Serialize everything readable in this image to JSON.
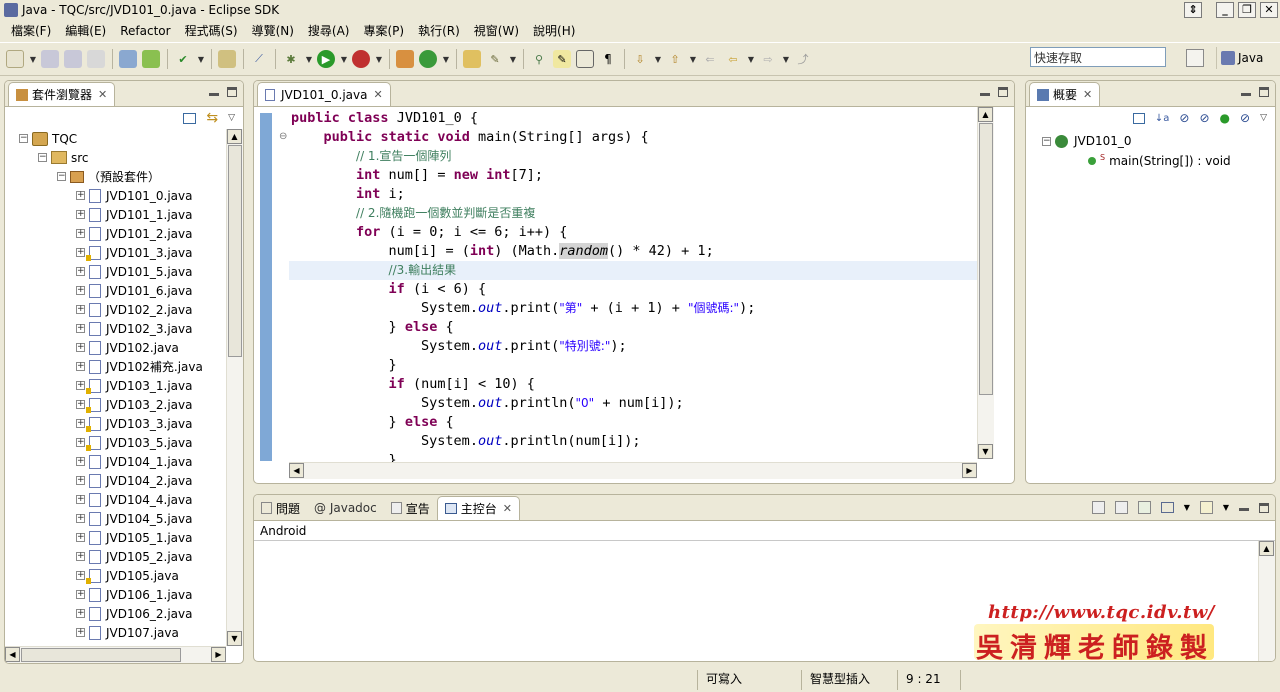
{
  "window": {
    "title": "Java - TQC/src/JVD101_0.java - Eclipse SDK"
  },
  "menu": [
    "檔案(F)",
    "編輯(E)",
    "Refactor",
    "程式碼(S)",
    "導覽(N)",
    "搜尋(A)",
    "專案(P)",
    "執行(R)",
    "視窗(W)",
    "說明(H)"
  ],
  "toolbar": {
    "quick_access": "快速存取",
    "perspective": "Java"
  },
  "package_explorer": {
    "tab": "套件瀏覽器",
    "project": "TQC",
    "src": "src",
    "package": "（預設套件）",
    "files": [
      "JVD101_0.java",
      "JVD101_1.java",
      "JVD101_2.java",
      "JVD101_3.java",
      "JVD101_5.java",
      "JVD101_6.java",
      "JVD102_2.java",
      "JVD102_3.java",
      "JVD102.java",
      "JVD102補充.java",
      "JVD103_1.java",
      "JVD103_2.java",
      "JVD103_3.java",
      "JVD103_5.java",
      "JVD104_1.java",
      "JVD104_2.java",
      "JVD104_4.java",
      "JVD104_5.java",
      "JVD105_1.java",
      "JVD105_2.java",
      "JVD105.java",
      "JVD106_1.java",
      "JVD106_2.java",
      "JVD107.java"
    ],
    "warnings": [
      false,
      false,
      false,
      true,
      false,
      false,
      false,
      false,
      false,
      false,
      true,
      true,
      true,
      true,
      false,
      false,
      false,
      false,
      false,
      false,
      true,
      false,
      false,
      false
    ]
  },
  "editor": {
    "tab": "JVD101_0.java",
    "lines": [
      {
        "indent": "",
        "parts": [
          [
            "kw",
            "public"
          ],
          [
            "t",
            " "
          ],
          [
            "kw",
            "class"
          ],
          [
            "t",
            " JVD101_0 {"
          ]
        ]
      },
      {
        "indent": "    ",
        "parts": [
          [
            "kw",
            "public"
          ],
          [
            "t",
            " "
          ],
          [
            "kw",
            "static"
          ],
          [
            "t",
            " "
          ],
          [
            "kw",
            "void"
          ],
          [
            "t",
            " main(String[] args) {"
          ]
        ]
      },
      {
        "indent": "        ",
        "parts": [
          [
            "cm",
            "// 1.宣告一個陣列"
          ]
        ]
      },
      {
        "indent": "        ",
        "parts": [
          [
            "kw",
            "int"
          ],
          [
            "t",
            " num[] = "
          ],
          [
            "kw",
            "new"
          ],
          [
            "t",
            " "
          ],
          [
            "kw",
            "int"
          ],
          [
            "t",
            "[7];"
          ]
        ]
      },
      {
        "indent": "        ",
        "parts": [
          [
            "kw",
            "int"
          ],
          [
            "t",
            " i;"
          ]
        ]
      },
      {
        "indent": "        ",
        "parts": [
          [
            "cm",
            "// 2.隨機跑一個數並判斷是否重複"
          ]
        ]
      },
      {
        "indent": "        ",
        "parts": [
          [
            "kw",
            "for"
          ],
          [
            "t",
            " (i = 0; i <= 6; i++) {"
          ]
        ]
      },
      {
        "indent": "            ",
        "parts": [
          [
            "t",
            "num[i] = ("
          ],
          [
            "kw",
            "int"
          ],
          [
            "t",
            ") (Math."
          ],
          [
            "sel",
            "random"
          ],
          [
            "t",
            "() * 42) + 1;"
          ]
        ]
      },
      {
        "indent": "            ",
        "parts": [
          [
            "cm",
            "//3.輸出結果"
          ]
        ]
      },
      {
        "indent": "            ",
        "parts": [
          [
            "kw",
            "if"
          ],
          [
            "t",
            " (i < 6) {"
          ]
        ]
      },
      {
        "indent": "                ",
        "parts": [
          [
            "t",
            "System."
          ],
          [
            "it",
            "out"
          ],
          [
            "t",
            ".print("
          ],
          [
            "st",
            "\"第\""
          ],
          [
            "t",
            " + (i + 1) + "
          ],
          [
            "st",
            "\"個號碼:\""
          ],
          [
            "t",
            ");"
          ]
        ]
      },
      {
        "indent": "            ",
        "parts": [
          [
            "t",
            "} "
          ],
          [
            "kw",
            "else"
          ],
          [
            "t",
            " {"
          ]
        ]
      },
      {
        "indent": "                ",
        "parts": [
          [
            "t",
            "System."
          ],
          [
            "it",
            "out"
          ],
          [
            "t",
            ".print("
          ],
          [
            "st",
            "\"特別號:\""
          ],
          [
            "t",
            ");"
          ]
        ]
      },
      {
        "indent": "            ",
        "parts": [
          [
            "t",
            "}"
          ]
        ]
      },
      {
        "indent": "            ",
        "parts": [
          [
            "kw",
            "if"
          ],
          [
            "t",
            " (num[i] < 10) {"
          ]
        ]
      },
      {
        "indent": "                ",
        "parts": [
          [
            "t",
            "System."
          ],
          [
            "it",
            "out"
          ],
          [
            "t",
            ".println("
          ],
          [
            "st",
            "\"0\""
          ],
          [
            "t",
            " + num[i]);"
          ]
        ]
      },
      {
        "indent": "            ",
        "parts": [
          [
            "t",
            "} "
          ],
          [
            "kw",
            "else"
          ],
          [
            "t",
            " {"
          ]
        ]
      },
      {
        "indent": "                ",
        "parts": [
          [
            "t",
            "System."
          ],
          [
            "it",
            "out"
          ],
          [
            "t",
            ".println(num[i]);"
          ]
        ]
      },
      {
        "indent": "            ",
        "parts": [
          [
            "t",
            "}"
          ]
        ]
      }
    ],
    "current_line": 8
  },
  "outline": {
    "tab": "概要",
    "class_name": "JVD101_0",
    "method": "main(String[]) : void",
    "static_marker": "S"
  },
  "bottom": {
    "tabs": [
      "問題",
      "@ Javadoc",
      "宣告",
      "主控台"
    ],
    "active_tab": "主控台",
    "console_title": "Android"
  },
  "status": {
    "writable": "可寫入",
    "insert_mode": "智慧型插入",
    "position": "9 : 21"
  },
  "watermark": {
    "url": "http://www.tqc.idv.tw/",
    "name": "吳清輝老師錄製"
  },
  "colors": {
    "keyword": "#7f0055",
    "comment": "#3f7f5f",
    "string": "#2a00ff",
    "field": "#0000c0",
    "chrome": "#ece9d8"
  }
}
